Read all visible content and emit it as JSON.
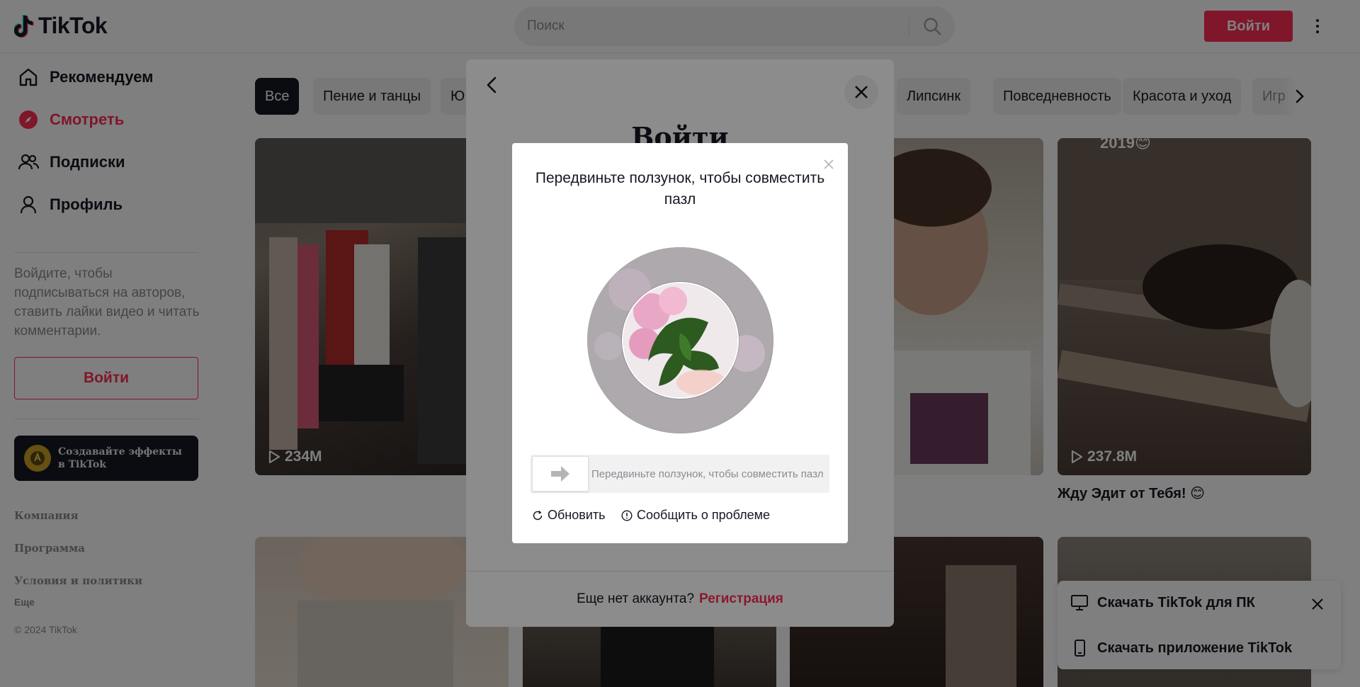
{
  "app": {
    "logo_text": "TikTok"
  },
  "header": {
    "search_placeholder": "Поиск",
    "login_label": "Войти"
  },
  "sidebar": {
    "nav": [
      {
        "label": "Рекомендуем",
        "icon": "home-icon"
      },
      {
        "label": "Смотреть",
        "icon": "compass-icon",
        "active": true
      },
      {
        "label": "Подписки",
        "icon": "users-icon"
      },
      {
        "label": "Профиль",
        "icon": "profile-icon"
      }
    ],
    "hint": "Войдите, чтобы подписываться на авторов, ставить лайки видео и читать комментарии.",
    "login_label": "Войти",
    "effects_banner": "Создавайте эффекты в TikTok",
    "footer": {
      "company": "Компания",
      "program": "Программа",
      "terms": "Условия и политики",
      "more": "Еще",
      "copyright": "© 2024 TikTok"
    }
  },
  "categories": {
    "items": [
      "Все",
      "Пение и танцы",
      "Ю",
      "Липсинк",
      "Повседневность",
      "Красота и уход",
      "Игр"
    ],
    "active": "Все"
  },
  "videos": [
    {
      "views": "234M",
      "title": ""
    },
    {
      "views": "",
      "title": ""
    },
    {
      "views": "237.8M",
      "title": "Жду Эдит от Тебя! 😊",
      "overlay_text": "2019😊"
    }
  ],
  "download_panel": {
    "pc_label": "Скачать TikTok для ПК",
    "app_label": "Скачать приложение TikTok"
  },
  "login_modal": {
    "title": "Войти",
    "footer_text": "Еще нет аккаунта?",
    "signup_label": "Регистрация"
  },
  "captcha": {
    "title": "Передвиньте ползунок, чтобы совместить пазл",
    "slider_hint": "Передвиньте ползунок, чтобы совместить пазл",
    "refresh_label": "Обновить",
    "report_label": "Сообщить о проблеме"
  },
  "colors": {
    "brand": "#fe2c55",
    "text": "#161823",
    "muted": "#8a8b91"
  }
}
